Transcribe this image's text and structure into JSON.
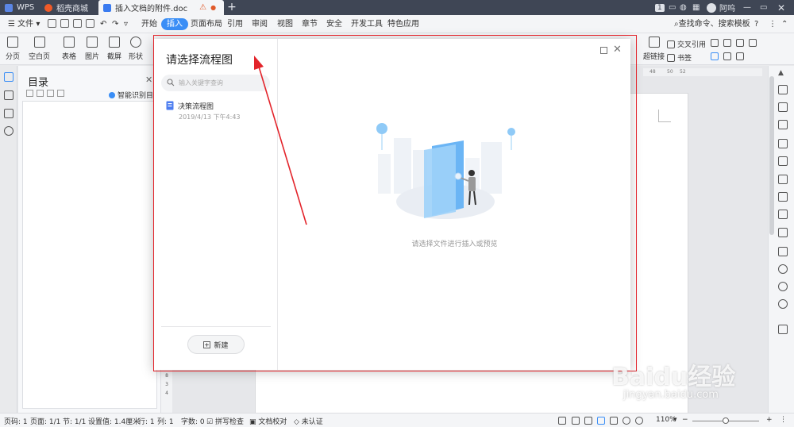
{
  "tabs": [
    {
      "label": "WPS",
      "icon": "wps-logo-icon"
    },
    {
      "label": "稻壳商城",
      "icon": "daoke-icon"
    },
    {
      "label": "插入文档的附件.doc",
      "icon": "word-doc-icon",
      "active": true
    }
  ],
  "titlebar": {
    "badge": "1",
    "user": "阿呜"
  },
  "menu": {
    "file": "文件",
    "items": [
      "开始",
      "插入",
      "页面布局",
      "引用",
      "审阅",
      "视图",
      "章节",
      "安全",
      "开发工具",
      "特色应用"
    ],
    "active": "插入",
    "search": "查找命令、搜索模板",
    "help": "?"
  },
  "ribbon": {
    "buttons": [
      "分页",
      "空白页",
      "表格",
      "图片",
      "截屏",
      "形状"
    ],
    "right": {
      "hyperlink": "超链接",
      "cross_ref": "交叉引用",
      "bookmark": "书签"
    }
  },
  "ruler": [
    "48",
    "50",
    "52"
  ],
  "toc": {
    "title": "目录",
    "smart": "智能识别目录"
  },
  "vruler": [
    "4",
    "8",
    "3",
    "4"
  ],
  "dialog": {
    "title": "请选择流程图",
    "search_placeholder": "输入关键字查询",
    "file_name": "决策流程图",
    "file_date": "2019/4/13 下午4:43",
    "new_button": "新建",
    "hint": "请选择文件进行插入或预览"
  },
  "status": {
    "page": "页码: 1",
    "pages": "页面: 1/1",
    "section": "节: 1/1",
    "setting": "设置值: 1.4厘米",
    "row": "行: 1",
    "col": "列: 1",
    "words": "字数: 0",
    "spell": "拼写检查",
    "proof": "文档校对",
    "cert": "未认证",
    "zoom": "110%",
    "zoom_level": 0.5
  },
  "watermark": {
    "brand": "Baidu经验",
    "url": "jingyan.baidu.com"
  },
  "colors": {
    "accent": "#3a8ef6",
    "annotation": "#e3242b",
    "tabbar": "#3f4655"
  }
}
